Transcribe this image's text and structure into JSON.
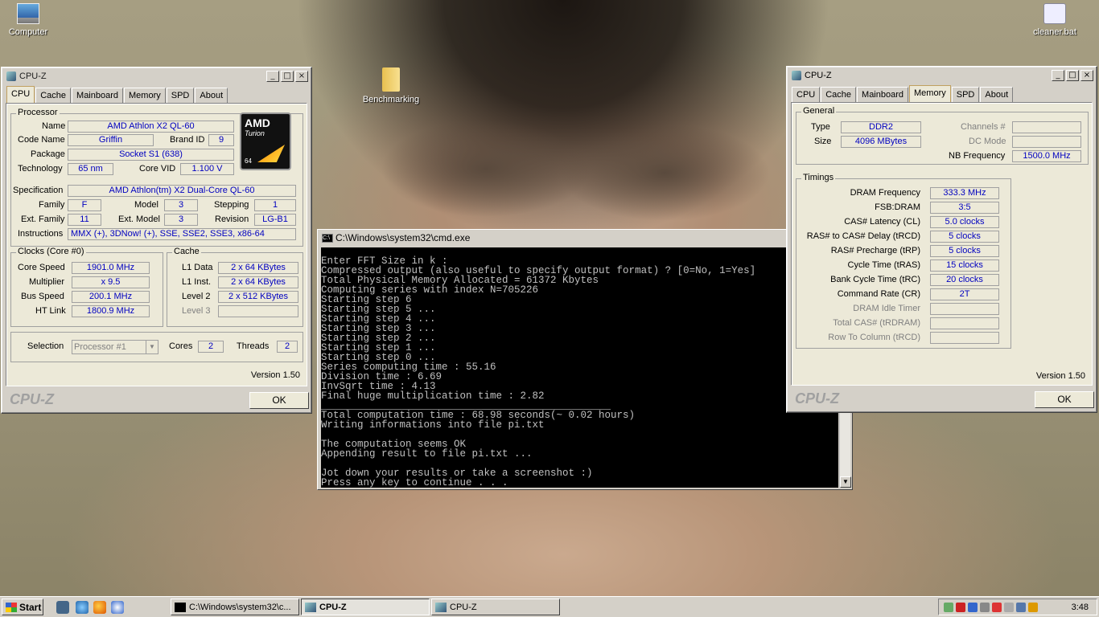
{
  "desktop": {
    "icons": [
      {
        "label": "Computer"
      },
      {
        "label": "Benchmarking"
      },
      {
        "label": "cleaner.bat"
      }
    ]
  },
  "cpuz_left": {
    "title": "CPU-Z",
    "tabs": [
      "CPU",
      "Cache",
      "Mainboard",
      "Memory",
      "SPD",
      "About"
    ],
    "processor": {
      "group": "Processor",
      "name_label": "Name",
      "name": "AMD Athlon X2 QL-60",
      "codename_label": "Code Name",
      "codename": "Griffin",
      "brandid_label": "Brand ID",
      "brandid": "9",
      "package_label": "Package",
      "package": "Socket S1 (638)",
      "tech_label": "Technology",
      "tech": "65 nm",
      "corevid_label": "Core VID",
      "corevid": "1.100 V",
      "spec_label": "Specification",
      "spec": "AMD Athlon(tm) X2 Dual-Core QL-60",
      "family_label": "Family",
      "family": "F",
      "model_label": "Model",
      "model": "3",
      "stepping_label": "Stepping",
      "stepping": "1",
      "extfam_label": "Ext. Family",
      "extfam": "11",
      "extmodel_label": "Ext. Model",
      "extmodel": "3",
      "revision_label": "Revision",
      "revision": "LG-B1",
      "instr_label": "Instructions",
      "instr": "MMX (+), 3DNow! (+), SSE, SSE2, SSE3, x86-64",
      "logo_top": "AMD",
      "logo_mid": "Turion",
      "logo_bot": "64"
    },
    "clocks": {
      "group": "Clocks (Core #0)",
      "corespeed_label": "Core Speed",
      "corespeed": "1901.0 MHz",
      "mult_label": "Multiplier",
      "mult": "x 9.5",
      "bus_label": "Bus Speed",
      "bus": "200.1 MHz",
      "ht_label": "HT Link",
      "ht": "1800.9 MHz"
    },
    "cache": {
      "group": "Cache",
      "l1d_label": "L1 Data",
      "l1d": "2 x 64 KBytes",
      "l1i_label": "L1 Inst.",
      "l1i": "2 x 64 KBytes",
      "l2_label": "Level 2",
      "l2": "2 x 512 KBytes",
      "l3_label": "Level 3",
      "l3": ""
    },
    "selection": {
      "label": "Selection",
      "value": "Processor #1",
      "cores_label": "Cores",
      "cores": "2",
      "threads_label": "Threads",
      "threads": "2"
    },
    "version": "Version 1.50",
    "brand": "CPU-Z",
    "ok": "OK"
  },
  "cpuz_right": {
    "title": "CPU-Z",
    "tabs": [
      "CPU",
      "Cache",
      "Mainboard",
      "Memory",
      "SPD",
      "About"
    ],
    "general": {
      "group": "General",
      "type_label": "Type",
      "type": "DDR2",
      "channels_label": "Channels #",
      "channels": "",
      "size_label": "Size",
      "size": "4096 MBytes",
      "dcmode_label": "DC Mode",
      "dcmode": "",
      "nbfreq_label": "NB Frequency",
      "nbfreq": "1500.0 MHz"
    },
    "timings": {
      "group": "Timings",
      "rows": [
        {
          "label": "DRAM Frequency",
          "value": "333.3 MHz",
          "dis": false
        },
        {
          "label": "FSB:DRAM",
          "value": "3:5",
          "dis": false
        },
        {
          "label": "CAS# Latency (CL)",
          "value": "5.0 clocks",
          "dis": false
        },
        {
          "label": "RAS# to CAS# Delay (tRCD)",
          "value": "5 clocks",
          "dis": false
        },
        {
          "label": "RAS# Precharge (tRP)",
          "value": "5 clocks",
          "dis": false
        },
        {
          "label": "Cycle Time (tRAS)",
          "value": "15 clocks",
          "dis": false
        },
        {
          "label": "Bank Cycle Time (tRC)",
          "value": "20 clocks",
          "dis": false
        },
        {
          "label": "Command Rate (CR)",
          "value": "2T",
          "dis": false
        },
        {
          "label": "DRAM Idle Timer",
          "value": "",
          "dis": true
        },
        {
          "label": "Total CAS# (tRDRAM)",
          "value": "",
          "dis": true
        },
        {
          "label": "Row To Column (tRCD)",
          "value": "",
          "dis": true
        }
      ]
    },
    "version": "Version 1.50",
    "brand": "CPU-Z",
    "ok": "OK"
  },
  "cmd": {
    "title": "C:\\Windows\\system32\\cmd.exe",
    "lines": [
      "Enter FFT Size in k :",
      "Compressed output (also useful to specify output format) ? [0=No, 1=Yes]",
      "Total Physical Memory Allocated = 61372 Kbytes",
      "Computing series with index N=705226",
      "Starting step 6",
      "Starting step 5 ...",
      "Starting step 4 ...",
      "Starting step 3 ...",
      "Starting step 2 ...",
      "Starting step 1 ...",
      "Starting step 0 ...",
      "Series computing time : 55.16",
      "Division time : 6.69",
      "InvSqrt time : 4.13",
      "Final huge multiplication time : 2.82",
      "________________________________________________",
      "Total computation time : 68.98 seconds(~ 0.02 hours)",
      "Writing informations into file pi.txt",
      "",
      "The computation seems OK",
      "Appending result to file pi.txt ...",
      "",
      "Jot down your results or take a screenshot :)",
      "Press any key to continue . . ."
    ]
  },
  "taskbar": {
    "start": "Start",
    "buttons": [
      {
        "label": "C:\\Windows\\system32\\c..."
      },
      {
        "label": "CPU-Z"
      },
      {
        "label": "CPU-Z"
      }
    ],
    "clock": "3:48"
  },
  "colors": {
    "field_text": "#0000c0",
    "console_bg": "#000000",
    "console_text": "#c0c0c0"
  }
}
